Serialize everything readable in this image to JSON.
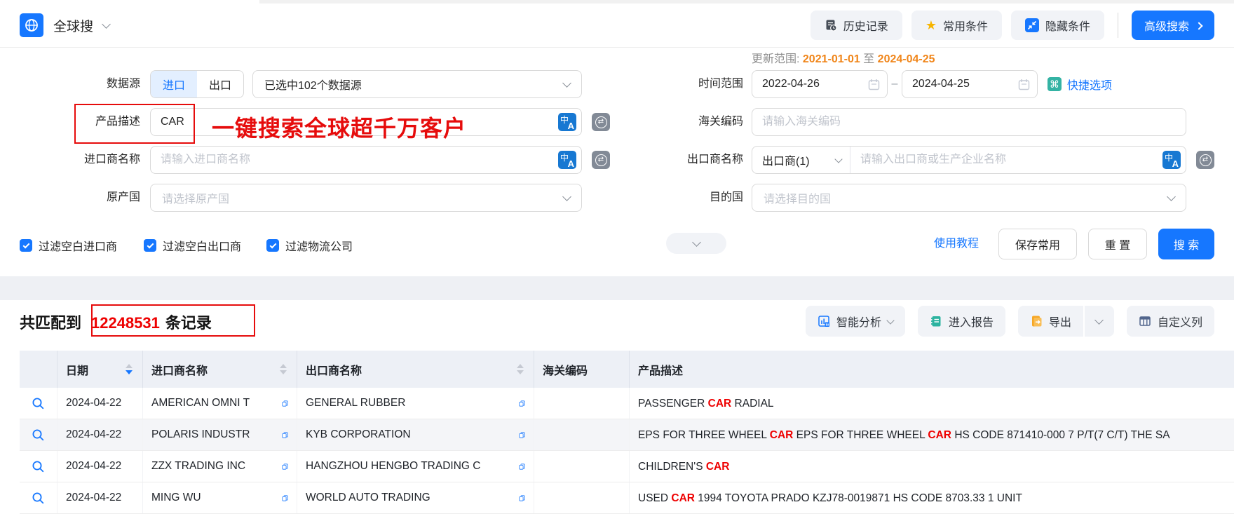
{
  "header": {
    "app_title": "全球搜",
    "buttons": {
      "history": "历史记录",
      "favorites": "常用条件",
      "hide_conditions": "隐藏条件",
      "advanced_search": "高级搜索"
    }
  },
  "form": {
    "update_range": {
      "label": "更新范围:",
      "start": "2021-01-01",
      "separator": "至",
      "end": "2024-04-25"
    },
    "data_source": {
      "label": "数据源",
      "import_tab": "进口",
      "export_tab": "出口",
      "selected_text": "已选中102个数据源"
    },
    "time_range": {
      "label": "时间范围",
      "start": "2022-04-26",
      "separator": "–",
      "end": "2024-04-25"
    },
    "shortcut_link": "快捷选项",
    "product_desc": {
      "label": "产品描述",
      "value": "CAR"
    },
    "hs_code": {
      "label": "海关编码",
      "placeholder": "请输入海关编码"
    },
    "importer_name": {
      "label": "进口商名称",
      "placeholder": "请输入进口商名称"
    },
    "exporter_name": {
      "label": "出口商名称",
      "type_selector": "出口商(1)",
      "placeholder": "请输入出口商或生产企业名称"
    },
    "origin_country": {
      "label": "原产国",
      "placeholder": "请选择原产国"
    },
    "destination_country": {
      "label": "目的国",
      "placeholder": "请选择目的国"
    },
    "filters": [
      {
        "label": "过滤空白进口商",
        "checked": true
      },
      {
        "label": "过滤空白出口商",
        "checked": true
      },
      {
        "label": "过滤物流公司",
        "checked": true
      }
    ],
    "tutorial_link": "使用教程",
    "save_button": "保存常用",
    "reset_button": "重 置",
    "search_button": "搜 索"
  },
  "annotations": {
    "product_desc_note": "一键搜索全球超千万客户"
  },
  "results": {
    "summary": {
      "prefix": "共匹配到",
      "count": "12248531",
      "suffix": "条记录"
    },
    "actions": {
      "analysis": "智能分析",
      "report": "进入报告",
      "export": "导出",
      "custom_columns": "自定义列"
    },
    "table": {
      "columns": [
        "日期",
        "进口商名称",
        "出口商名称",
        "海关编码",
        "产品描述"
      ],
      "highlight_term": "CAR",
      "rows": [
        {
          "date": "2024-04-22",
          "importer": "AMERICAN OMNI T",
          "exporter": "GENERAL RUBBER",
          "hs_code": "",
          "description": [
            {
              "t": "PASSENGER "
            },
            {
              "t": "CAR",
              "hl": true
            },
            {
              "t": " RADIAL"
            }
          ]
        },
        {
          "date": "2024-04-22",
          "importer": "POLARIS INDUSTR",
          "exporter": "KYB CORPORATION",
          "hs_code": "",
          "description": [
            {
              "t": "EPS FOR THREE WHEEL "
            },
            {
              "t": "CAR",
              "hl": true
            },
            {
              "t": " EPS FOR THREE WHEEL "
            },
            {
              "t": "CAR",
              "hl": true
            },
            {
              "t": " HS CODE 871410-000 7 P/T(7 C/T) THE SA"
            }
          ]
        },
        {
          "date": "2024-04-22",
          "importer": "ZZX TRADING INC",
          "exporter": "HANGZHOU HENGBO TRADING C",
          "hs_code": "",
          "description": [
            {
              "t": "CHILDREN'S "
            },
            {
              "t": "CAR",
              "hl": true
            }
          ]
        },
        {
          "date": "2024-04-22",
          "importer": "MING WU",
          "exporter": "WORLD AUTO TRADING",
          "hs_code": "",
          "description": [
            {
              "t": "USED "
            },
            {
              "t": "CAR",
              "hl": true
            },
            {
              "t": " 1994 TOYOTA PRADO KZJ78-0019871 HS CODE 8703.33 1 UNIT"
            }
          ]
        }
      ]
    }
  },
  "colors": {
    "primary": "#1677ff",
    "annotation_red": "#e60c0c",
    "highlight_red": "#ee0000",
    "update_range_orange": "#f08519",
    "star_gold": "#f7b500",
    "shortcut_teal": "#34b3a4"
  }
}
